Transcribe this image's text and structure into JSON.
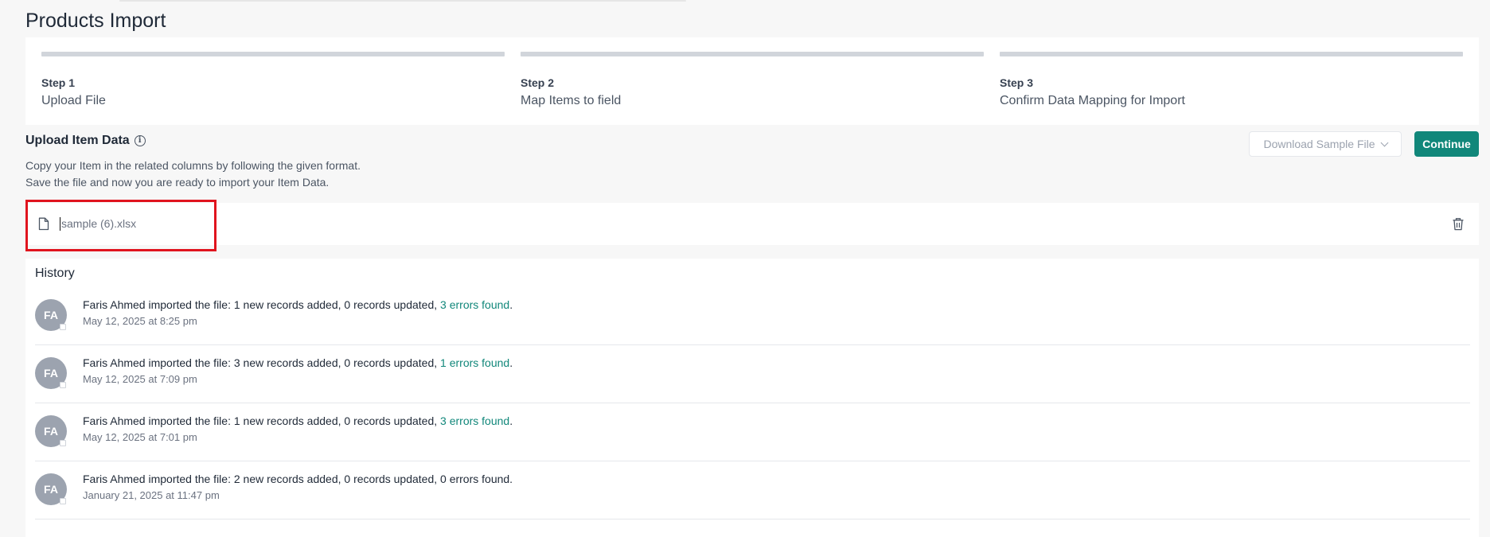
{
  "page": {
    "title": "Products Import"
  },
  "steps": [
    {
      "number": "Step 1",
      "name": "Upload File"
    },
    {
      "number": "Step 2",
      "name": "Map Items to field"
    },
    {
      "number": "Step 3",
      "name": "Confirm Data Mapping for Import"
    }
  ],
  "upload": {
    "title": "Upload Item Data",
    "info_icon": "info-icon",
    "desc_line1": "Copy your Item in the related columns by following the given format.",
    "desc_line2": "Save the file and now you are ready to import your Item Data.",
    "download_sample_label": "Download Sample File",
    "continue_label": "Continue"
  },
  "file": {
    "name": "sample (6).xlsx",
    "icon": "file-icon",
    "delete_icon": "trash-icon"
  },
  "history": {
    "title": "History",
    "entries": [
      {
        "initials": "FA",
        "text": "Faris Ahmed imported the file: 1 new records added, 0 records updated, ",
        "errors": "3 errors found",
        "suffix": ".",
        "time": "May 12, 2025 at 8:25 pm"
      },
      {
        "initials": "FA",
        "text": "Faris Ahmed imported the file: 3 new records added, 0 records updated, ",
        "errors": "1 errors found",
        "suffix": ".",
        "time": "May 12, 2025 at 7:09 pm"
      },
      {
        "initials": "FA",
        "text": "Faris Ahmed imported the file: 1 new records added, 0 records updated, ",
        "errors": "3 errors found",
        "suffix": ".",
        "time": "May 12, 2025 at 7:01 pm"
      },
      {
        "initials": "FA",
        "text": "Faris Ahmed imported the file: 2 new records added, 0 records updated, 0 errors found.",
        "errors": "",
        "suffix": "",
        "time": "January 21, 2025 at 11:47 pm"
      }
    ]
  },
  "colors": {
    "accent": "#11877a",
    "highlight": "#e0141e",
    "avatar": "#9ca3af"
  }
}
